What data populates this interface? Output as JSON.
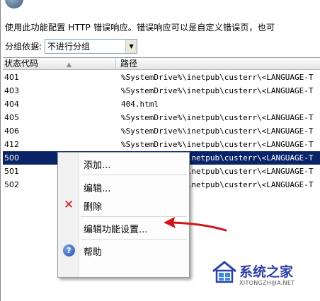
{
  "description": "使用此功能配置 HTTP 错误响应。错误响应可以是自定义错误页，也可",
  "group_by": {
    "label": "分组依据:",
    "selected": "不进行分组"
  },
  "columns": {
    "status": "状态代码",
    "path": "路径"
  },
  "rows": [
    {
      "code": "401",
      "path": "%SystemDrive%\\inetpub\\custerr\\<LANGUAGE-T"
    },
    {
      "code": "403",
      "path": "%SystemDrive%\\inetpub\\custerr\\<LANGUAGE-T"
    },
    {
      "code": "404",
      "path": "404.html"
    },
    {
      "code": "405",
      "path": "%SystemDrive%\\inetpub\\custerr\\<LANGUAGE-T"
    },
    {
      "code": "406",
      "path": "%SystemDrive%\\inetpub\\custerr\\<LANGUAGE-T"
    },
    {
      "code": "412",
      "path": "%SystemDrive%\\inetpub\\custerr\\<LANGUAGE-T"
    },
    {
      "code": "500",
      "path": "%SystemDrive%\\inetpub\\custerr\\<LANGUAGE-T"
    },
    {
      "code": "501",
      "path": "%SystemDrive%\\inetpub\\custerr\\<LANGUAGE-T"
    },
    {
      "code": "502",
      "path": "%SystemDrive%\\inetpub\\custerr\\<LANGUAGE-T"
    }
  ],
  "selected_row": "500",
  "context_menu": {
    "add": "添加...",
    "edit": "编辑...",
    "delete": "删除",
    "edit_feature_settings": "编辑功能设置...",
    "help": "帮助"
  },
  "icons": {
    "delete": "delete-x-icon",
    "help": "help-icon",
    "sort": "sort-ascending-icon",
    "dropdown": "chevron-down-icon"
  },
  "colors": {
    "selection": "#0a246a",
    "delete_icon": "#d11a1a",
    "arrow": "#d0141a",
    "watermark": "#2d3fa6"
  },
  "watermark": {
    "title": "系统之家",
    "url": "XITONGZHIJIA.NET"
  }
}
